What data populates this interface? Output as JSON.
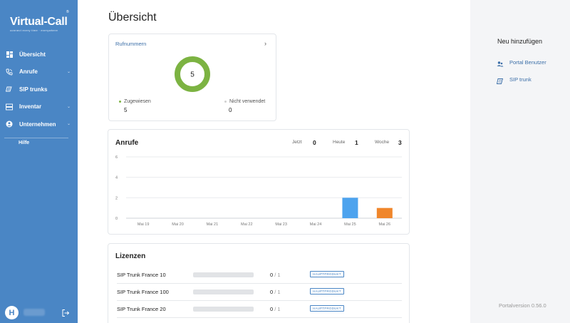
{
  "sidebar": {
    "logo": {
      "main": "Virtual-Call",
      "sub": "connect every time · everywhere",
      "reg": "®"
    },
    "items": [
      {
        "label": "Übersicht",
        "icon": "dashboard-icon",
        "has_submenu": false
      },
      {
        "label": "Anrufe",
        "icon": "phone-icon",
        "has_submenu": true
      },
      {
        "label": "SIP trunks",
        "icon": "sip-trunk-icon",
        "has_submenu": false
      },
      {
        "label": "Inventar",
        "icon": "inventory-icon",
        "has_submenu": true
      },
      {
        "label": "Unternehmen",
        "icon": "company-icon",
        "has_submenu": true
      }
    ],
    "help_label": "Hilfe",
    "user_initial": "H"
  },
  "main": {
    "title": "Übersicht",
    "rufnummern": {
      "title": "Rufnummern",
      "total": "5",
      "assigned_label": "Zugewiesen",
      "assigned_value": "5",
      "unused_label": "Nicht verwendet",
      "unused_value": "0",
      "colors": {
        "assigned": "#7cb342",
        "unused": "#d0d0d0"
      }
    },
    "anrufe": {
      "title": "Anrufe",
      "stats": [
        {
          "label": "Jetzt",
          "value": "0"
        },
        {
          "label": "Heute",
          "value": "1"
        },
        {
          "label": "Woche",
          "value": "3"
        }
      ]
    },
    "lizenzen": {
      "title": "Lizenzen",
      "rows": [
        {
          "name": "SIP Trunk France 10",
          "used": "0",
          "total": "/ 1",
          "badge": "HAUPTPRODUKT"
        },
        {
          "name": "SIP Trunk France 100",
          "used": "0",
          "total": "/ 1",
          "badge": "HAUPTPRODUKT"
        },
        {
          "name": "SIP Trunk France 20",
          "used": "0",
          "total": "/ 1",
          "badge": "HAUPTPRODUKT"
        }
      ]
    }
  },
  "right_panel": {
    "title": "Neu hinzufügen",
    "items": [
      {
        "label": "Portal Benutzer",
        "icon": "users-icon"
      },
      {
        "label": "SIP trunk",
        "icon": "sip-trunk-icon"
      }
    ],
    "version": "Portalversion 0.56.0"
  },
  "chart_data": {
    "type": "bar",
    "categories": [
      "Mai 19",
      "Mai 20",
      "Mai 21",
      "Mai 22",
      "Mai 23",
      "Mai 24",
      "Mai 25",
      "Mai 26"
    ],
    "series": [
      {
        "values": [
          0,
          0,
          0,
          0,
          0,
          0,
          2,
          0
        ],
        "color": "#4da3ee"
      },
      {
        "values": [
          0,
          0,
          0,
          0,
          0,
          0,
          0,
          1
        ],
        "color": "#f0862b"
      }
    ],
    "y_ticks": [
      "0",
      "2",
      "4",
      "6"
    ],
    "ylim": [
      0,
      6
    ],
    "grid": true
  }
}
